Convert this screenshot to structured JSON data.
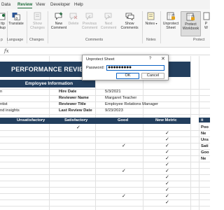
{
  "menu": {
    "tabs": [
      "Data",
      "Review",
      "View",
      "Developer",
      "Help"
    ],
    "active": "Review"
  },
  "ribbon": {
    "groups": {
      "proofing_partial": "p",
      "language": "Language",
      "changes": "Changes",
      "comments": "Comments",
      "notes": "Notes",
      "protect": "Protect"
    },
    "buttons": {
      "accessibility_partial": "ttp\nkup",
      "translate": "Translate",
      "show_changes": "Show\nChanges",
      "new_comment": "New\nComment",
      "delete": "Delete",
      "previous": "Previous\nComment",
      "next": "Next\nComment",
      "show_comments": "Show\nComments",
      "notes": "Notes",
      "unprotect_sheet": "Unprotect\nSheet",
      "protect_workbook": "Protect\nWorkbook",
      "edge": "P\nW"
    }
  },
  "formula_bar": {
    "fx": "fx",
    "name_box_partial": ""
  },
  "sheet": {
    "title": "PERFORMANCE REVIEW",
    "employee_info_header": "Employee Information",
    "left_partials": [
      "n",
      "",
      "ntist",
      "nd insights"
    ],
    "info_labels": [
      "Hire Date",
      "Reviewer Name",
      "Reviewer Title",
      "Last Review Date"
    ],
    "info_values": [
      "5/3/2021",
      "Margaret Teacher",
      "Employee Relations Manager",
      "9/23/2023"
    ],
    "metric_headers": [
      "Unsatisfactory",
      "Satisfactory",
      "Good",
      "New Metric"
    ],
    "right_panel_labels": [
      "Poo",
      "Ne",
      "Uns",
      "Sati",
      "Goo",
      "Ne"
    ],
    "right_panel_partial_header": "it",
    "check_symbol": "✓"
  },
  "dialog": {
    "title": "Unprotect Sheet",
    "help": "?",
    "close": "✕",
    "password_label": "Password:",
    "password_value": "●●●●●●●●●",
    "ok": "OK",
    "cancel": "Cancel"
  },
  "colors": {
    "banner": "#233f5e",
    "accent_green": "#1e6c3b",
    "focus_blue": "#0b62c4"
  }
}
